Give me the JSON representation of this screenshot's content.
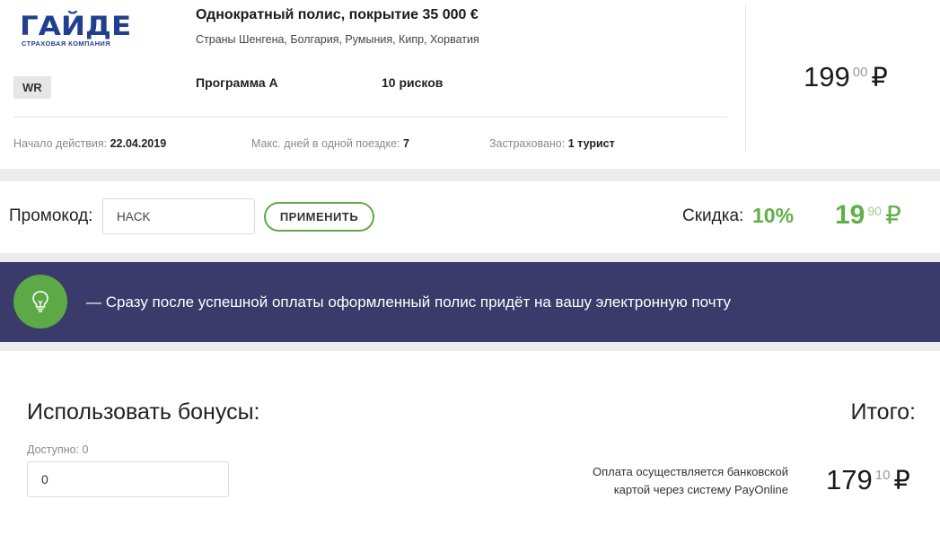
{
  "policy": {
    "company": {
      "logo_main": "ГАЙДЕ",
      "logo_sub": "СТРАХОВАЯ КОМПАНИЯ",
      "brand_color": "#1f3f8f"
    },
    "tag": "WR",
    "title": "Однократный полис, покрытие 35 000 €",
    "countries": "Страны Шенгена, Болгария, Румыния, Кипр, Хорватия",
    "program": "Программа А",
    "risks": "10 рисков",
    "start_label": "Начало действия:",
    "start_value": "22.04.2019",
    "max_days_label": "Макс. дней в одной поездке:",
    "max_days_value": "7",
    "insured_label": "Застраховано:",
    "insured_value": "1 турист",
    "price_main": "199",
    "price_cents": "00",
    "currency": "₽"
  },
  "promo": {
    "label": "Промокод:",
    "input_value": "HACK",
    "apply_label": "ПРИМЕНИТЬ",
    "discount_label": "Скидка:",
    "discount_percent": "10%",
    "discount_main": "19",
    "discount_cents": "90",
    "currency": "₽",
    "accent_color": "#5fb047"
  },
  "banner": {
    "icon": "lightbulb-icon",
    "text": "—   Сразу после успешной оплаты оформленный полис придёт на вашу электронную почту",
    "bg_color": "#3a3b6b",
    "icon_bg_color": "#5da946"
  },
  "bonuses": {
    "title": "Использовать бонусы:",
    "available": "Доступно: 0",
    "input_value": "0"
  },
  "total": {
    "title": "Итого:",
    "payment_note_line1": "Оплата осуществляется банковской",
    "payment_note_line2": "картой через систему PayOnline",
    "price_main": "179",
    "price_cents": "10",
    "currency": "₽"
  }
}
